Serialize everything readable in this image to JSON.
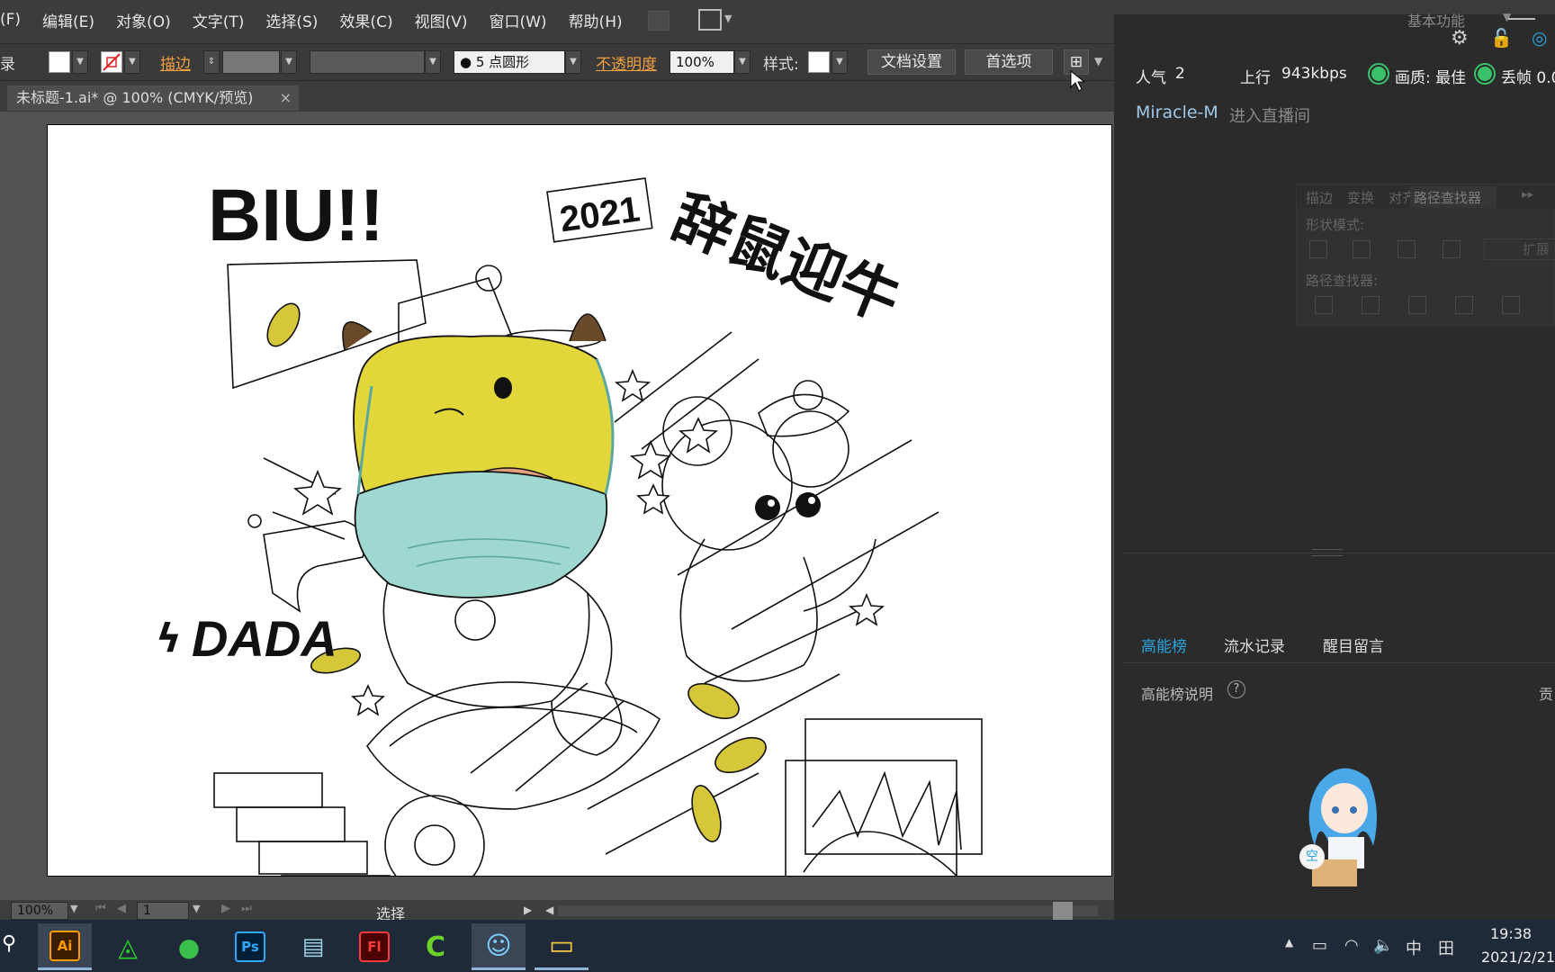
{
  "menubar": {
    "items": [
      "(F)",
      "编辑(E)",
      "对象(O)",
      "文字(T)",
      "选择(S)",
      "效果(C)",
      "视图(V)",
      "窗口(W)",
      "帮助(H)"
    ]
  },
  "controlbar": {
    "left_glyph": "录",
    "stroke_label": "描边",
    "stroke_arrows": "⇕",
    "brush_value": "● 5 点圆形",
    "opacity_label": "不透明度",
    "opacity_value": "100%",
    "style_label": "样式:",
    "doc_setup_button": "文档设置",
    "prefs_button": "首选项"
  },
  "document": {
    "tab_title": "未标题-1.ai* @ 100% (CMYK/预览)",
    "tab_close": "×"
  },
  "artwork": {
    "text_biu": "BIU!!",
    "text_year": "2021",
    "text_slogan": "辞鼠迎牛",
    "text_dada": "DADA",
    "dada_mark": "ϟ"
  },
  "statusbar": {
    "zoom": "100%",
    "page": "1",
    "tool": "选择"
  },
  "stream_panel": {
    "workspace_label": "基本功能",
    "popularity_label": "人气",
    "popularity_value": "2",
    "upload_label": "上行",
    "upload_value": "943kbps",
    "quality_label": "画质: 最佳",
    "drop_label": "丢帧 0.0",
    "chat_user": "Miracle-M",
    "chat_msg": "进入直播间",
    "tabs": [
      "高能榜",
      "流水记录",
      "醒目留言"
    ],
    "board_desc": "高能榜说明",
    "board_help": "?",
    "board_right": "贡",
    "mascot_bubble": "空"
  },
  "pathfinder": {
    "tabs": [
      "描边",
      "变换",
      "对齐",
      "路径查找器"
    ],
    "shape_modes": "形状模式:",
    "expand": "扩展",
    "pathfinders": "路径查找器:"
  },
  "taskbar": {
    "apps": [
      {
        "label": "Ai",
        "bg": "#3b1d00",
        "fg": "#ff9a00"
      },
      {
        "label": "◬",
        "bg": "#1f2a38",
        "fg": "#2bd12b"
      },
      {
        "label": "●",
        "bg": "#1f2a38",
        "fg": "#39c04a"
      },
      {
        "label": "Ps",
        "bg": "#001e36",
        "fg": "#31a8ff"
      },
      {
        "label": "▤",
        "bg": "#1f2a38",
        "fg": "#9fd3e8"
      },
      {
        "label": "Fl",
        "bg": "#4a0000",
        "fg": "#ff3c3c"
      },
      {
        "label": "C",
        "bg": "#1f2a38",
        "fg": "#6bd12b"
      },
      {
        "label": "☺",
        "bg": "#1f2a38",
        "fg": "#7fd0ff"
      },
      {
        "label": "▭",
        "bg": "#1f2a38",
        "fg": "#f5c842"
      }
    ],
    "tray_arrow": "▲",
    "ime": "中",
    "ime2": "田",
    "time": "19:38",
    "date": "2021/2/21"
  },
  "colors": {
    "accent_blue": "#2aa5e0",
    "status_green": "#3ac26a",
    "stroke_orange": "#f0a040",
    "ox_yellow": "#e2d73a",
    "mask_teal": "#9fd8d0"
  }
}
